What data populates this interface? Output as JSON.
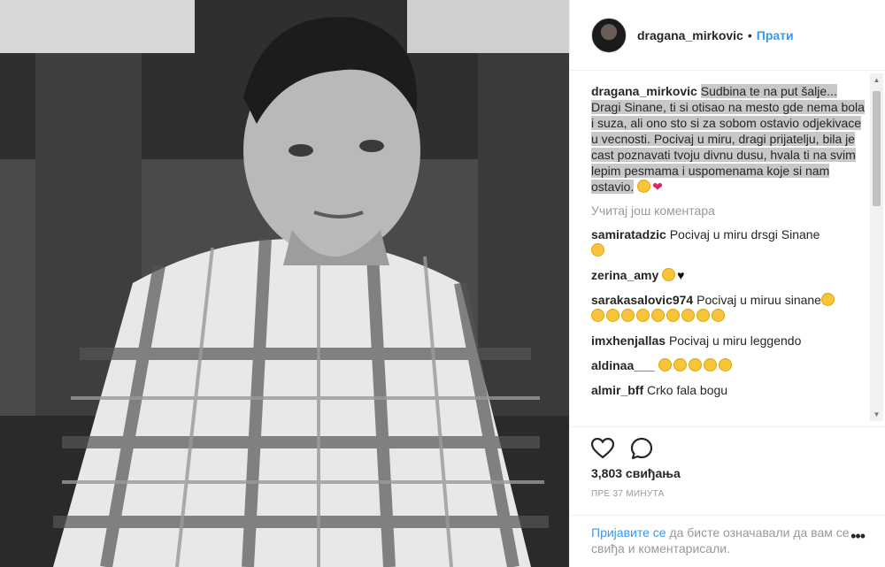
{
  "header": {
    "username": "dragana_mirkovic",
    "separator": "•",
    "follow_label": "Прати"
  },
  "caption": {
    "username": "dragana_mirkovic",
    "text": "Sudbina te na put šalje... Dragi Sinane, ti si otisao na mesto gde nema bola i suza, ali ono sto si za sobom ostavio odjekivace u vecnosti. Pocivaj u miru, dragi prijatelju, bila je cast poznavati tvoju divnu dusu, hvala ti na svim lepim pesmama i uspomenama koje si nam ostavio."
  },
  "load_more": "Учитај још коментара",
  "comments": [
    {
      "user": "samiratadzic",
      "text": "Pocivaj u miru drsgi Sinane"
    },
    {
      "user": "zerina_amy",
      "text": ""
    },
    {
      "user": "sarakasalovic974",
      "text": "Pocivaj u miruu sinane"
    },
    {
      "user": "imxhenjallas",
      "text": "Pocivaj u miru leggendo"
    },
    {
      "user": "aldinaa___",
      "text": ""
    },
    {
      "user": "almir_bff",
      "text": "Crko fala bogu"
    }
  ],
  "likes": "3,803 свиђања",
  "time": "ПРЕ 37 МИНУТА",
  "login": {
    "link": "Пријавите се",
    "text": " да бисте означавали да вам се свиђа и коментарисали.",
    "more": "•••"
  },
  "icons": {
    "like": "heart-outline-icon",
    "comment": "speech-bubble-icon",
    "emoji": "sad-face-emoji",
    "heart": "red-heart-emoji"
  },
  "colors": {
    "link": "#3897f0",
    "muted": "#999999",
    "text": "#262626"
  }
}
